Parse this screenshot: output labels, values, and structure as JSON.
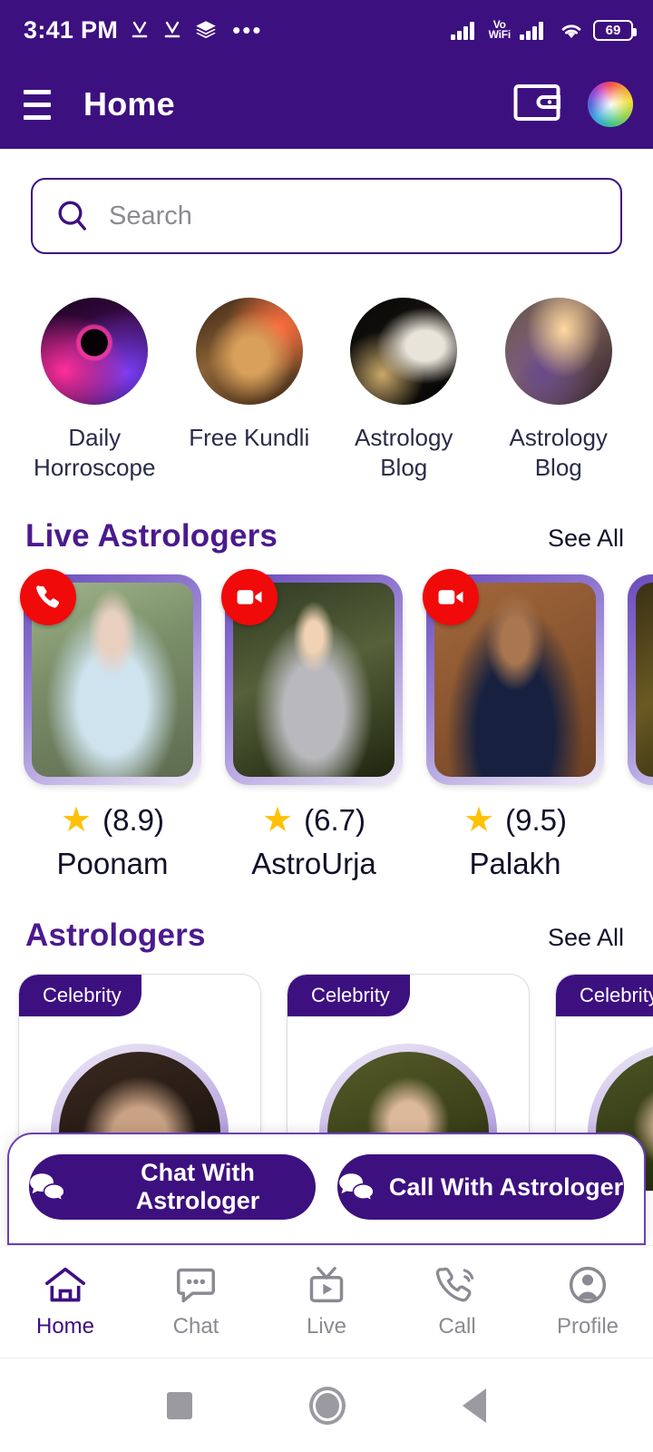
{
  "status_bar": {
    "time": "3:41 PM",
    "icons": [
      "download-check-icon",
      "download-check-icon",
      "layers-icon",
      "more-dots-icon"
    ],
    "network_label_top": "Vo",
    "network_label_bottom": "WiFi",
    "battery_level": "69"
  },
  "header": {
    "title": "Home",
    "menu_icon": "hamburger-icon",
    "wallet_icon": "wallet-icon",
    "avatar_icon": "color-wheel-avatar"
  },
  "search": {
    "placeholder": "Search",
    "icon": "search-icon"
  },
  "categories": [
    {
      "label": "Daily Horroscope",
      "art": "art-horoscope"
    },
    {
      "label": "Free Kundli",
      "art": "art-kundli"
    },
    {
      "label": "Astrology Blog",
      "art": "art-blog1"
    },
    {
      "label": "Astrology Blog",
      "art": "art-blog2"
    }
  ],
  "live_section": {
    "title": "Live Astrologers",
    "see_all": "See All",
    "items": [
      {
        "name": "Poonam",
        "rating": "(8.9)",
        "badge": "phone-icon",
        "photo": "ph-poonam"
      },
      {
        "name": "AstroUrja",
        "rating": "(6.7)",
        "badge": "video-icon",
        "photo": "ph-urja"
      },
      {
        "name": "Palakh",
        "rating": "(9.5)",
        "badge": "video-icon",
        "photo": "ph-palakh"
      }
    ],
    "star_glyph": "★"
  },
  "astrologers_section": {
    "title": "Astrologers",
    "see_all": "See All",
    "items": [
      {
        "badge": "Celebrity",
        "avatar": "av-1"
      },
      {
        "badge": "Celebrity",
        "avatar": "av-2"
      },
      {
        "badge": "Celebrity",
        "avatar": "av-3"
      }
    ]
  },
  "cta": {
    "chat_label": "Chat With Astrologer",
    "call_label": "Call With Astrologer",
    "chat_icon": "chat-bubbles-icon",
    "call_icon": "chat-bubbles-icon"
  },
  "bottom_nav": {
    "items": [
      {
        "label": "Home",
        "icon": "home-icon",
        "active": true
      },
      {
        "label": "Chat",
        "icon": "chat-icon",
        "active": false
      },
      {
        "label": "Live",
        "icon": "tv-play-icon",
        "active": false
      },
      {
        "label": "Call",
        "icon": "call-icon",
        "active": false
      },
      {
        "label": "Profile",
        "icon": "profile-icon",
        "active": false
      }
    ]
  },
  "system_nav": {
    "recents": "square-recents-icon",
    "home": "circle-home-icon",
    "back": "triangle-back-icon"
  },
  "colors": {
    "brand_purple": "#3D1080",
    "heading_purple": "#4B1A8E",
    "badge_red": "#F00A0A",
    "star_gold": "#FFC107"
  }
}
